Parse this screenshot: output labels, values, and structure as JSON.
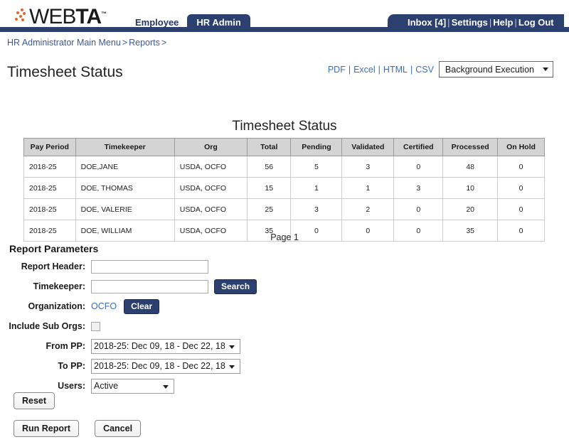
{
  "header": {
    "logo": {
      "part1": "WEB",
      "part2": "TA",
      "tm": "™"
    },
    "tabs": [
      {
        "label": "Employee",
        "active": false
      },
      {
        "label": "HR Admin",
        "active": true
      }
    ],
    "nav_right": {
      "inbox": "Inbox [4]",
      "settings": "Settings",
      "help": "Help",
      "logout": "Log Out",
      "separator": "|"
    }
  },
  "breadcrumb": {
    "item1": "HR Administrator Main Menu",
    "arrow1": ">",
    "item2": "Reports",
    "arrow2": ">"
  },
  "page_title": "Timesheet Status",
  "export": {
    "pdf": "PDF",
    "excel": "Excel",
    "html": "HTML",
    "csv": "CSV",
    "separator": "|",
    "background_execution": "Background Execution"
  },
  "report": {
    "title": "Timesheet Status",
    "page_label": "Page 1",
    "columns": [
      "Pay Period",
      "Timekeeper",
      "Org",
      "Total",
      "Pending",
      "Validated",
      "Certified",
      "Processed",
      "On Hold"
    ],
    "rows": [
      {
        "pay_period": "2018-25",
        "timekeeper": "DOE,JANE",
        "org": "USDA, OCFO",
        "total": "56",
        "pending": "5",
        "validated": "3",
        "certified": "0",
        "processed": "48",
        "on_hold": "0"
      },
      {
        "pay_period": "2018-25",
        "timekeeper": "DOE, THOMAS",
        "org": "USDA, OCFO",
        "total": "15",
        "pending": "1",
        "validated": "1",
        "certified": "3",
        "processed": "10",
        "on_hold": "0"
      },
      {
        "pay_period": "2018-25",
        "timekeeper": "DOE, VALERIE",
        "org": "USDA, OCFO",
        "total": "25",
        "pending": "3",
        "validated": "2",
        "certified": "0",
        "processed": "20",
        "on_hold": "0"
      },
      {
        "pay_period": "2018-25",
        "timekeeper": "DOE, WILLIAM",
        "org": "USDA, OCFO",
        "total": "35",
        "pending": "0",
        "validated": "0",
        "certified": "0",
        "processed": "35",
        "on_hold": "0"
      }
    ]
  },
  "params": {
    "heading": "Report Parameters",
    "report_header": {
      "label": "Report Header:",
      "value": "",
      "placeholder": ""
    },
    "timekeeper": {
      "label": "Timekeeper:",
      "value": "",
      "placeholder": "",
      "search_button": "Search"
    },
    "organization": {
      "label": "Organization:",
      "value": "OCFO",
      "clear_button": "Clear"
    },
    "include_sub_orgs": {
      "label": "Include Sub Orgs:",
      "checked": false
    },
    "from_pp": {
      "label": "From PP:",
      "value": "2018-25: Dec 09, 18 - Dec 22, 18"
    },
    "to_pp": {
      "label": "To PP:",
      "value": "2018-25: Dec 09, 18 - Dec 22, 18"
    },
    "users": {
      "label": "Users:",
      "value": "Active"
    }
  },
  "buttons": {
    "reset": "Reset",
    "run_report": "Run Report",
    "cancel": "Cancel"
  },
  "colors": {
    "navy": "#2b406e",
    "link_blue": "#3b6fb8",
    "breadcrumb_blue": "#3b5998",
    "logo_orange": "#e8622a",
    "table_header_gray": "#d4d4d4"
  }
}
